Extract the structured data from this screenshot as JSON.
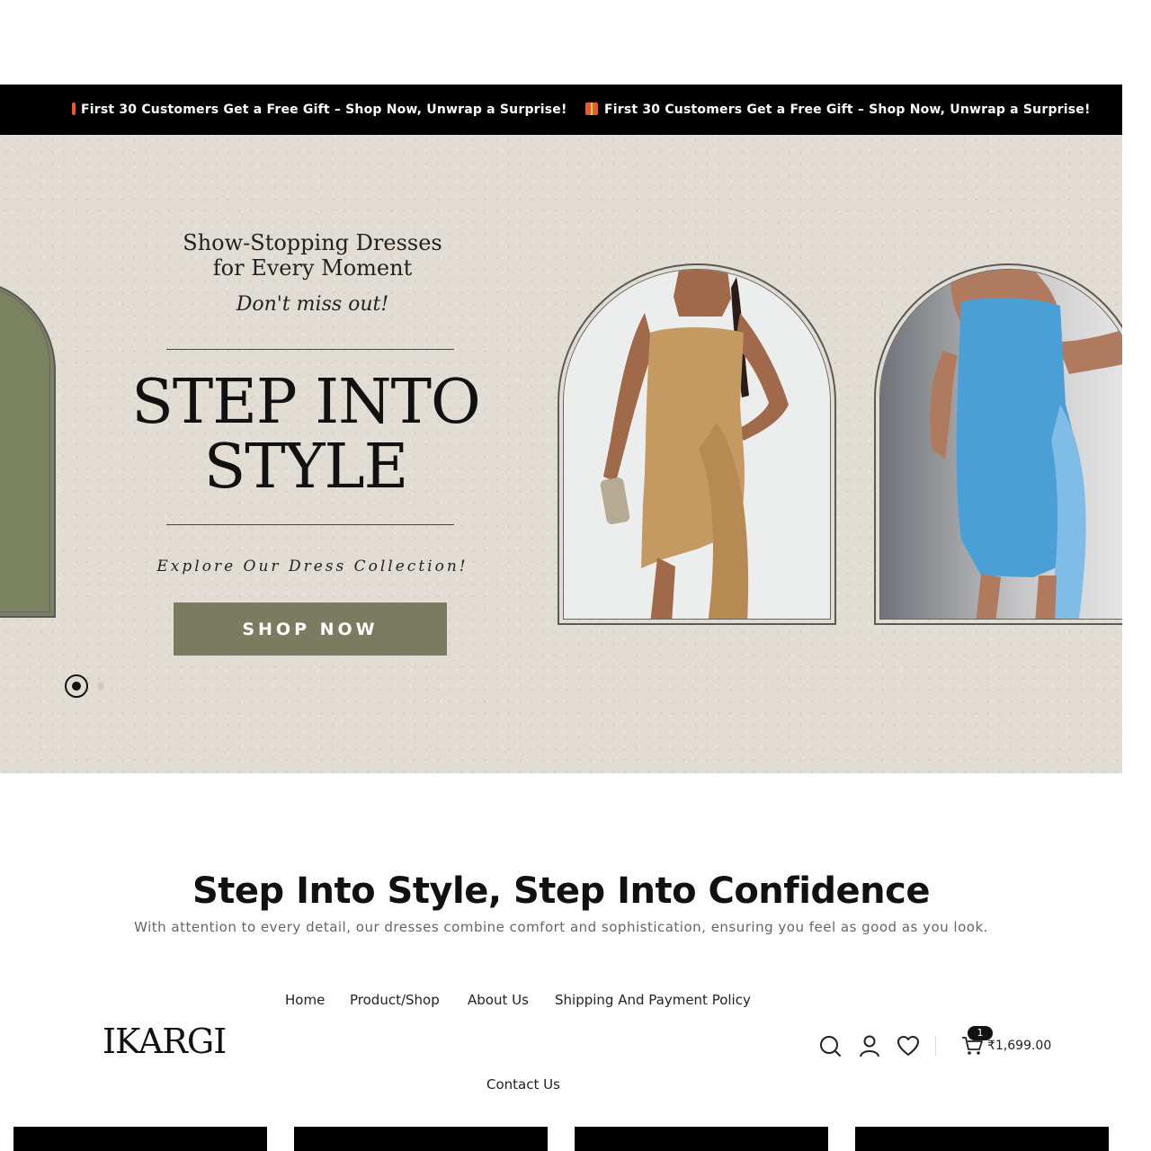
{
  "announcement": {
    "items": [
      {
        "text": "First 30 Customers Get a Free Gift – Shop Now, Unwrap a Surprise!"
      },
      {
        "text": "First 30 Customers Get a Free Gift – Shop Now, Unwrap a Surprise!"
      }
    ]
  },
  "hero": {
    "subtitle_line1": "Show-Stopping Dresses",
    "subtitle_line2": "for Every Moment",
    "tagline": "Don't miss out!",
    "title_line1": "STEP INTO",
    "title_line2": "STYLE",
    "explore": "Explore Our Dress Collection!",
    "cta_label": "SHOP NOW"
  },
  "section": {
    "heading": "Step Into Style, Step Into Confidence",
    "subtext": "With attention to every detail, our dresses combine comfort and sophistication, ensuring you feel as good as you look."
  },
  "header": {
    "logo": "IKARGI",
    "nav": [
      {
        "label": "Home"
      },
      {
        "label": "Product/Shop"
      },
      {
        "label": "About Us"
      },
      {
        "label": "Shipping And Payment Policy"
      },
      {
        "label": "Contact Us"
      }
    ],
    "cart_count": "1",
    "cart_total": "₹1,699.00"
  },
  "colors": {
    "announcement_bg": "#000000",
    "hero_bg": "#e2ddd4",
    "cta_bg": "#7b7c5f",
    "accent_green": "#7b8260",
    "dress_gold": "#c49a62",
    "dress_blue": "#4a9fd6"
  },
  "icons": [
    "gift-icon",
    "search-icon",
    "user-icon",
    "heart-icon",
    "cart-icon"
  ]
}
